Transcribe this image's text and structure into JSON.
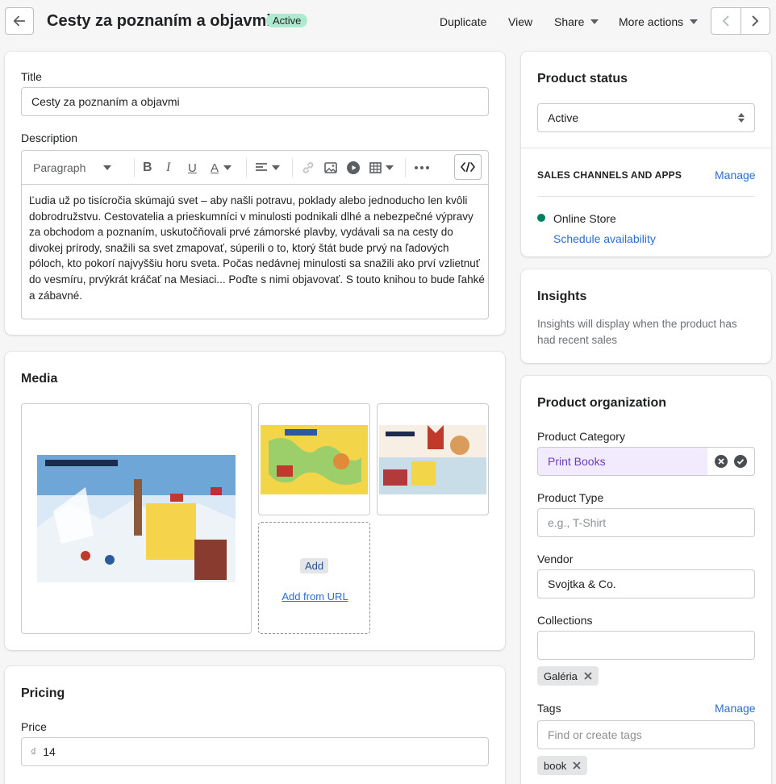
{
  "header": {
    "title": "Cesty za poznaním a objavmi",
    "status_badge": "Active",
    "actions": {
      "duplicate": "Duplicate",
      "view": "View",
      "share": "Share",
      "more": "More actions"
    }
  },
  "details": {
    "title_label": "Title",
    "title_value": "Cesty za poznaním a objavmi",
    "description_label": "Description",
    "toolbar": {
      "paragraph": "Paragraph"
    },
    "description_text": "Ľudia už po tisícročia skúmajú svet – aby našli potravu, poklady alebo jednoducho len kvôli dobrodružstvu. Cestovatelia a prieskumníci v minulosti podnikali dlhé a nebezpečné výpravy za obchodom a poznaním, uskutočňovali prvé zámorské plavby, vydávali sa na cesty do divokej prírody, snažili sa svet zmapovať, súperili o to, ktorý štát bude prvý na ľadových póloch, kto pokorí najvyššiu horu sveta. Počas nedávnej minulosti sa snažili ako prví vzlietnuť do vesmíru, prvýkrát kráčať na Mesiaci... Poďte s nimi objavovať. S touto knihou to bude ľahké a zábavné."
  },
  "media": {
    "heading": "Media",
    "add_label": "Add",
    "add_url_label": "Add from URL"
  },
  "pricing": {
    "heading": "Pricing",
    "price_label": "Price",
    "currency_symbol": "₫",
    "price_value": "14"
  },
  "product_status": {
    "heading": "Product status",
    "selected": "Active",
    "channels_heading": "SALES CHANNELS AND APPS",
    "manage_label": "Manage",
    "channel_name": "Online Store",
    "schedule_label": "Schedule availability",
    "channel_color": "#007f5f"
  },
  "insights": {
    "heading": "Insights",
    "text": "Insights will display when the product has had recent sales"
  },
  "organization": {
    "heading": "Product organization",
    "category_label": "Product Category",
    "category_value": "Print Books",
    "category_bg": "#f1ebfd",
    "category_text_color": "#6d3fba",
    "type_label": "Product Type",
    "type_placeholder": "e.g., T-Shirt",
    "vendor_label": "Vendor",
    "vendor_value": "Svojtka & Co.",
    "collections_label": "Collections",
    "collection_tag": "Galéria",
    "tags_label": "Tags",
    "tags_manage": "Manage",
    "tags_placeholder": "Find or create tags",
    "tag_value": "book"
  }
}
